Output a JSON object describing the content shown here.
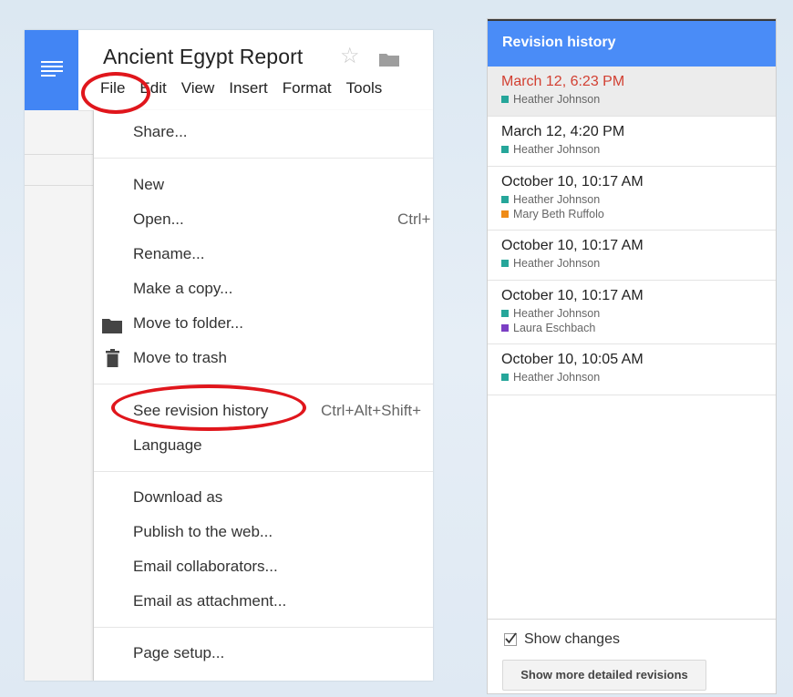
{
  "document": {
    "title": "Ancient Egypt Report"
  },
  "menubar": {
    "items": [
      "File",
      "Edit",
      "View",
      "Insert",
      "Format",
      "Tools"
    ]
  },
  "file_menu": {
    "share": "Share...",
    "new": "New",
    "open": "Open...",
    "open_shortcut": "Ctrl+",
    "rename": "Rename...",
    "make_copy": "Make a copy...",
    "move_to_folder": "Move to folder...",
    "move_to_trash": "Move to trash",
    "see_revision_history": "See revision history",
    "revision_shortcut": "Ctrl+Alt+Shift+",
    "language": "Language",
    "download_as": "Download as",
    "publish": "Publish to the web...",
    "email_collaborators": "Email collaborators...",
    "email_attachment": "Email as attachment...",
    "page_setup": "Page setup..."
  },
  "revision_panel": {
    "title": "Revision history",
    "revisions": [
      {
        "time": "March 12, 6:23 PM",
        "users": [
          {
            "name": "Heather Johnson",
            "color": "#26a69a"
          }
        ]
      },
      {
        "time": "March 12, 4:20 PM",
        "users": [
          {
            "name": "Heather Johnson",
            "color": "#26a69a"
          }
        ]
      },
      {
        "time": "October 10, 10:17 AM",
        "users": [
          {
            "name": "Heather Johnson",
            "color": "#26a69a"
          },
          {
            "name": "Mary Beth Ruffolo",
            "color": "#ef8b16"
          }
        ]
      },
      {
        "time": "October 10, 10:17 AM",
        "users": [
          {
            "name": "Heather Johnson",
            "color": "#26a69a"
          }
        ]
      },
      {
        "time": "October 10, 10:17 AM",
        "users": [
          {
            "name": "Heather Johnson",
            "color": "#26a69a"
          },
          {
            "name": "Laura Eschbach",
            "color": "#7b3fc4"
          }
        ]
      },
      {
        "time": "October 10, 10:05 AM",
        "users": [
          {
            "name": "Heather Johnson",
            "color": "#26a69a"
          }
        ]
      }
    ],
    "show_changes_label": "Show changes",
    "show_changes_checked": true,
    "more_button": "Show more detailed revisions"
  },
  "colors": {
    "brand_blue": "#4285f4",
    "panel_header": "#4a8cf7",
    "selected_time": "#d23f31",
    "annotation_red": "#e0161c"
  }
}
